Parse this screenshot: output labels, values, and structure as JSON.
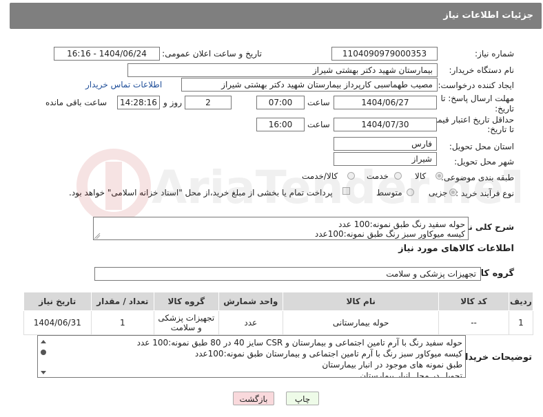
{
  "header": {
    "title": "جزئیات اطلاعات نیاز"
  },
  "labels": {
    "need_number": "شماره نیاز:",
    "announce_datetime": "تاریخ و ساعت اعلان عمومی:",
    "buyer_org": "نام دستگاه خریدار:",
    "requester": "ایجاد کننده درخواست:",
    "reply_deadline_line1": "مهلت ارسال پاسخ: تا",
    "reply_deadline_line2": "تاریخ:",
    "price_validity_line1": "حداقل تاریخ اعتبار قیمت:",
    "price_validity_line2": "تا تاریخ:",
    "hour": "ساعت",
    "day_and": "روز و",
    "remaining_time": "ساعت باقی مانده",
    "delivery_province": "استان محل تحویل:",
    "delivery_city": "شهر محل تحویل:",
    "category": "طبقه بندی موضوعی:",
    "purchase_type": "نوع فرآیند خرید :",
    "general_description": "شرح کلی نیاز:",
    "goods_info": "اطلاعات کالاهای مورد نیاز",
    "goods_group": "گروه کالا:",
    "buyer_notes": "توضیحات خریدار:"
  },
  "fields": {
    "need_number": "1104090979000353",
    "announce_datetime": "1404/06/24 - 16:16",
    "buyer_org": "بیمارستان شهید دکتر بهشتی شیراز",
    "requester": "مصیب طهماسبی کارپرداز بیمارستان شهید دکتر بهشتی شیراز",
    "buyer_contact_link": "اطلاعات تماس خریدار",
    "reply_date": "1404/06/27",
    "reply_time": "07:00",
    "reply_days": "2",
    "reply_remaining": "14:28:16",
    "price_date": "1404/07/30",
    "price_time": "16:00",
    "province": "فارس",
    "city": "شیراز",
    "goods_group": "تجهیزات پزشکی و سلامت"
  },
  "category_options": [
    {
      "label": "کالا",
      "selected": true
    },
    {
      "label": "خدمت",
      "selected": false
    },
    {
      "label": "کالا/خدمت",
      "selected": false
    }
  ],
  "purchase_options": [
    {
      "label": "جزیی",
      "selected": true
    },
    {
      "label": "متوسط",
      "selected": false
    }
  ],
  "payment_note": "پرداخت تمام یا بخشی از مبلغ خرید،از محل \"اسناد خزانه اسلامی\" خواهد بود.",
  "general_description": {
    "line1": "حوله سفید رنگ طبق نمونه:100 عدد",
    "line2": "کیسه میوکاور سبز رنگ طبق نمونه:100عدد"
  },
  "table": {
    "headers": [
      "ردیف",
      "کد کالا",
      "نام کالا",
      "واحد شمارش",
      "گروه کالا",
      "تعداد / مقدار",
      "تاریخ نیاز"
    ],
    "rows": [
      [
        "1",
        "--",
        "حوله بیمارستانی",
        "عدد",
        "تجهیزات پزشکی و سلامت",
        "1",
        "1404/06/31"
      ]
    ]
  },
  "buyer_notes": {
    "line1": "حوله سفید رنگ با آرم تامین اجتماعی و بیمارستان و CSR سایز 40 در 80 طبق نمونه:100 عدد",
    "line2": "کیسه میوکاور سبز رنگ با آرم تامین اجتماعی و بیمارستان طبق نمونه:100عدد",
    "line3": "طبق نمونه های موجود در انبار بیمارستان",
    "line4": "تحویل در محل انبار بیمارستان"
  },
  "buttons": {
    "print": "چاپ",
    "back": "بازگشت"
  },
  "colors": {
    "header_bg": "#7f7f7f",
    "link": "#1f4e99",
    "back_button_bg": "#f9d9dc",
    "print_button_bg": "#eefbe8"
  },
  "watermark": {
    "text": "AriaTender.neT"
  }
}
